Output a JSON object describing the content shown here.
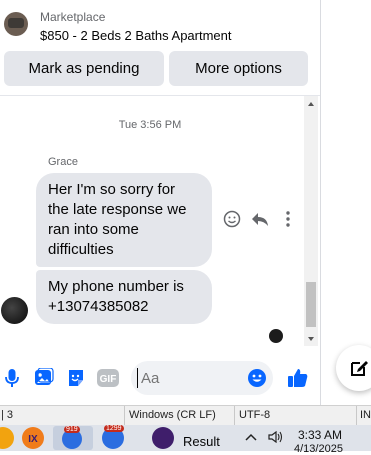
{
  "header": {
    "source": "Marketplace",
    "listing_title": "$850 - 2 Beds 2 Baths Apartment",
    "buttons": {
      "mark_pending": "Mark as pending",
      "more_options": "More options"
    }
  },
  "conversation": {
    "timestamp": "Tue 3:56 PM",
    "sender_name": "Grace",
    "messages": [
      "Her I'm so sorry for the late response we ran into some difficulties",
      "My phone number is +13074385082"
    ]
  },
  "composer": {
    "placeholder": "Aa",
    "icons": [
      "microphone-icon",
      "photo-icon",
      "sticker-icon",
      "gif-icon",
      "emoji-icon",
      "thumbs-up-icon"
    ],
    "gif_label": "GIF"
  },
  "floating_button_icon": "compose-icon",
  "status_bar": {
    "position": "| 3",
    "line_endings": "Windows (CR LF)",
    "encoding": "UTF-8",
    "mode": "IN"
  },
  "taskbar": {
    "result_label": "Result",
    "badge_one": "919",
    "badge_two": "1299",
    "time": "3:33 AM",
    "date": "4/13/2025"
  },
  "colors": {
    "accent": "#0866ff",
    "bubble": "#e4e6eb",
    "button_bg": "#e4e6eb"
  }
}
